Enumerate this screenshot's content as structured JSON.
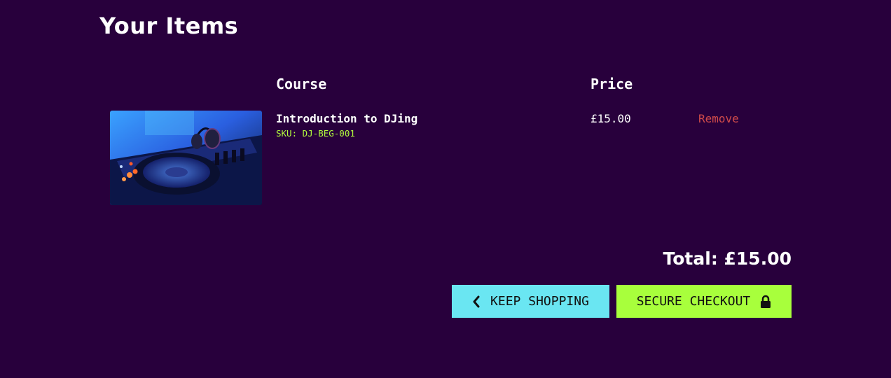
{
  "page": {
    "title": "Your Items"
  },
  "table": {
    "headers": {
      "course": "Course",
      "price": "Price"
    },
    "items": [
      {
        "name": "Introduction to DJing",
        "sku": "SKU: DJ-BEG-001",
        "price": "£15.00",
        "remove_label": "Remove",
        "image_subject": "dj-turntable-with-headphones"
      }
    ]
  },
  "summary": {
    "total_text": "Total: £15.00"
  },
  "actions": {
    "keep_shopping_label": "KEEP SHOPPING",
    "keep_shopping_icon": "chevron-left-icon",
    "checkout_label": "SECURE CHECKOUT",
    "checkout_icon": "lock-icon"
  },
  "colors": {
    "background": "#28003c",
    "sku": "#b4ff3c",
    "remove": "#d04a4a",
    "keep_shopping_button": "#6ae6f2",
    "checkout_button": "#a8ff3c"
  }
}
